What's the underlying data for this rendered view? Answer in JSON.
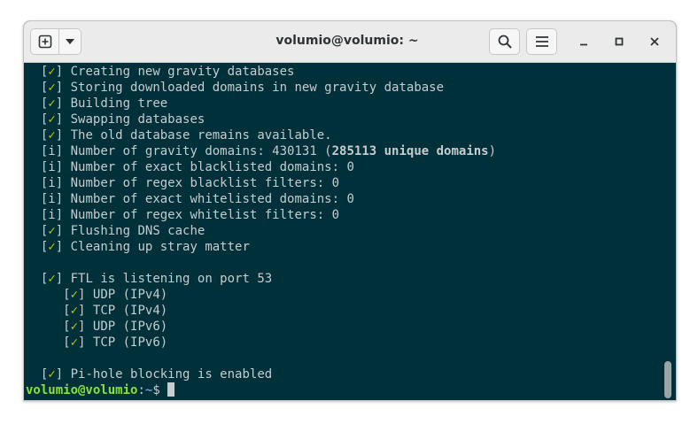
{
  "window": {
    "title": "volumio@volumio: ~",
    "controls": {
      "new_tab_icon": "plus-box-icon",
      "menu_icon": "chevron-down-icon",
      "search_icon": "search-icon",
      "hamburger_icon": "hamburger-menu-icon",
      "minimize_icon": "minimize-icon",
      "maximize_icon": "maximize-icon",
      "close_icon": "close-icon"
    }
  },
  "colors": {
    "terminal_background": "#00303a",
    "terminal_text": "#c7ccce",
    "check_mark": "#bfc800",
    "prompt_user": "#8ae234",
    "prompt_path": "#729fcf"
  },
  "terminal": {
    "lines": [
      {
        "indent": "  ",
        "open": "[",
        "mark": "✓",
        "close": "]",
        "text": " Creating new gravity databases"
      },
      {
        "indent": "  ",
        "open": "[",
        "mark": "✓",
        "close": "]",
        "text": " Storing downloaded domains in new gravity database"
      },
      {
        "indent": "  ",
        "open": "[",
        "mark": "✓",
        "close": "]",
        "text": " Building tree"
      },
      {
        "indent": "  ",
        "open": "[",
        "mark": "✓",
        "close": "]",
        "text": " Swapping databases"
      },
      {
        "indent": "  ",
        "open": "[",
        "mark": "✓",
        "close": "]",
        "text": " The old database remains available."
      },
      {
        "indent": "  ",
        "open": "[",
        "mark": "i",
        "close": "]",
        "text": " Number of gravity domains: 430131 (",
        "bold": "285113 unique domains",
        "tail": ")"
      },
      {
        "indent": "  ",
        "open": "[",
        "mark": "i",
        "close": "]",
        "text": " Number of exact blacklisted domains: 0"
      },
      {
        "indent": "  ",
        "open": "[",
        "mark": "i",
        "close": "]",
        "text": " Number of regex blacklist filters: 0"
      },
      {
        "indent": "  ",
        "open": "[",
        "mark": "i",
        "close": "]",
        "text": " Number of exact whitelisted domains: 0"
      },
      {
        "indent": "  ",
        "open": "[",
        "mark": "i",
        "close": "]",
        "text": " Number of regex whitelist filters: 0"
      },
      {
        "indent": "  ",
        "open": "[",
        "mark": "✓",
        "close": "]",
        "text": " Flushing DNS cache"
      },
      {
        "indent": "  ",
        "open": "[",
        "mark": "✓",
        "close": "]",
        "text": " Cleaning up stray matter"
      },
      {
        "indent": "",
        "open": "",
        "mark": "",
        "close": "",
        "text": ""
      },
      {
        "indent": "  ",
        "open": "[",
        "mark": "✓",
        "close": "]",
        "text": " FTL is listening on port 53"
      },
      {
        "indent": "     ",
        "open": "[",
        "mark": "✓",
        "close": "]",
        "text": " UDP (IPv4)"
      },
      {
        "indent": "     ",
        "open": "[",
        "mark": "✓",
        "close": "]",
        "text": " TCP (IPv4)"
      },
      {
        "indent": "     ",
        "open": "[",
        "mark": "✓",
        "close": "]",
        "text": " UDP (IPv6)"
      },
      {
        "indent": "     ",
        "open": "[",
        "mark": "✓",
        "close": "]",
        "text": " TCP (IPv6)"
      },
      {
        "indent": "",
        "open": "",
        "mark": "",
        "close": "",
        "text": ""
      },
      {
        "indent": "  ",
        "open": "[",
        "mark": "✓",
        "close": "]",
        "text": " Pi-hole blocking is enabled"
      }
    ],
    "prompt": {
      "user_host": "volumio@volumio",
      "separator": ":",
      "path": "~",
      "symbol": "$ "
    }
  }
}
